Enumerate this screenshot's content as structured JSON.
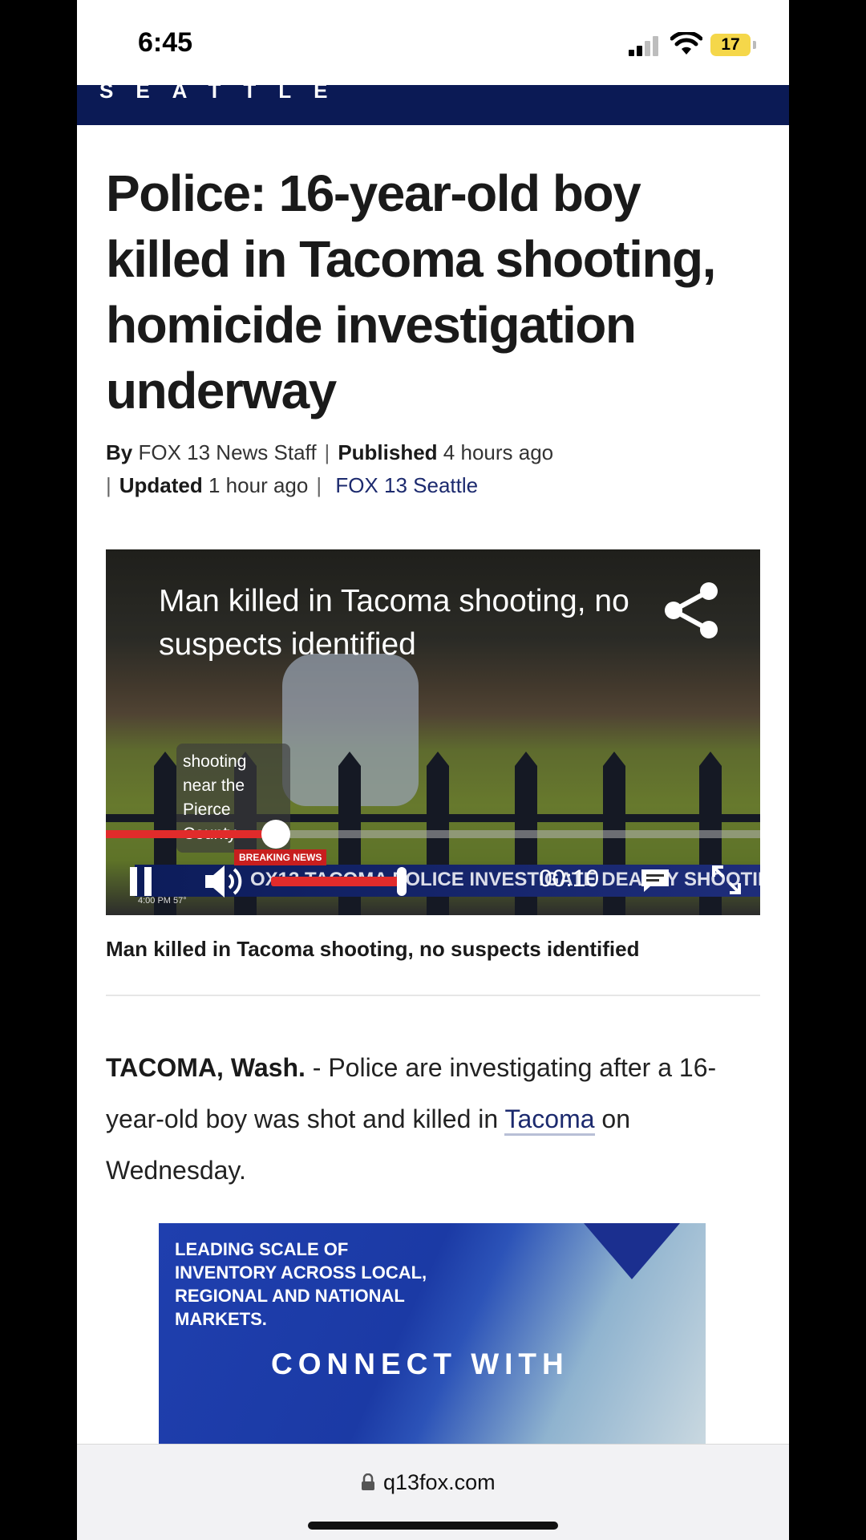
{
  "status_bar": {
    "time": "6:45",
    "battery": "17"
  },
  "site": {
    "band_text": "SEATTLE"
  },
  "article": {
    "headline": "Police: 16-year-old boy killed in Tacoma shooting, homicide investigation underway",
    "byline_prefix": "By",
    "byline_author": "FOX 13 News Staff",
    "published_label": "Published",
    "published_value": "4 hours ago",
    "updated_label": "Updated",
    "updated_value": "1 hour ago",
    "source_link": "FOX 13 Seattle",
    "lead_dateline": "TACOMA, Wash.",
    "lead_text_1": " - Police are investigating after a 16-year-old boy was shot and killed in ",
    "lead_link": "Tacoma",
    "lead_text_2": " on Wednesday."
  },
  "video": {
    "title": "Man killed in Tacoma shooting, no suspects identified",
    "caption_overlay": "shooting near the Pierce County",
    "breaking_tag": "BREAKING NEWS",
    "ticker": "OX13  TACOMA POLICE INVESTIGATE DEADLY SHOOTING",
    "station_info": "4:00 PM  57°",
    "timecode": "00:10",
    "progress": 0.26,
    "volume": 0.25,
    "caption_below": "Man killed in Tacoma shooting, no suspects identified"
  },
  "ad": {
    "copy": "LEADING SCALE OF INVENTORY ACROSS LOCAL, REGIONAL AND NATIONAL MARKETS.",
    "connect": "CONNECT WITH"
  },
  "browser": {
    "url": "q13fox.com"
  },
  "colors": {
    "brand_navy": "#0b1a55",
    "link": "#1c2a6e",
    "progress_red": "#e12b2b",
    "battery_yellow": "#f5d74a"
  }
}
